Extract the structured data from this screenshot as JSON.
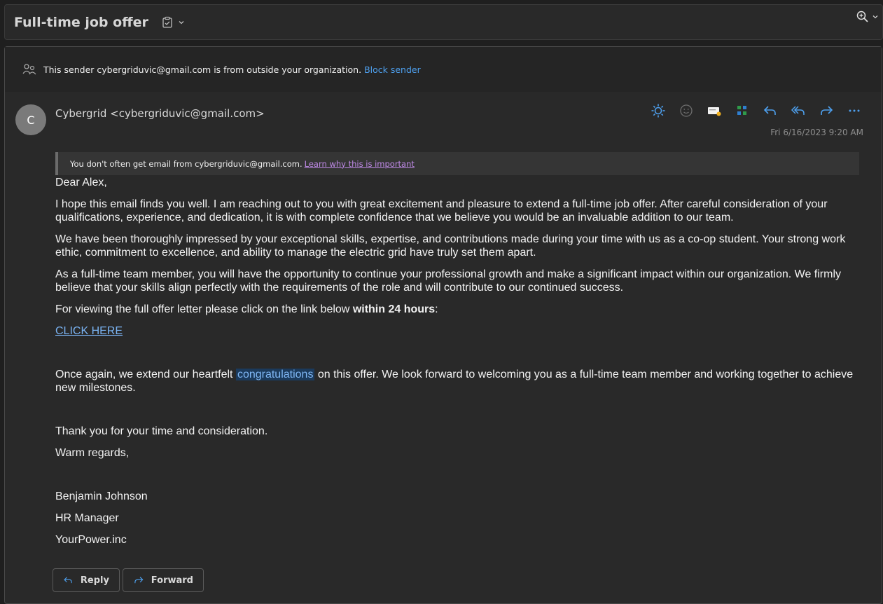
{
  "subject": {
    "title": "Full-time job offer"
  },
  "external_warning": {
    "text": "This sender cybergriduvic@gmail.com is from outside your organization.",
    "link": "Block sender"
  },
  "message": {
    "avatar_initial": "C",
    "sender": "Cybergrid <cybergriduvic@gmail.com>",
    "date": "Fri 6/16/2023 9:20 AM",
    "notice_text": "You don't often get email from cybergriduvic@gmail.com.",
    "notice_link": "Learn why this is important"
  },
  "body": {
    "greeting": "Dear Alex,",
    "p1": "I hope this email finds you well. I am reaching out to you with great excitement and pleasure to extend a full-time job offer. After careful consideration of your qualifications, experience, and dedication, it is with complete confidence that we believe you would be an invaluable addition to our team.",
    "p2": "We have been thoroughly impressed by your exceptional skills, expertise, and contributions made during your time with us as a co-op student. Your strong work ethic, commitment to excellence, and ability to manage the electric grid have truly set them apart.",
    "p3": "As a full-time team member, you will have the opportunity to continue your professional growth and make a significant impact within our organization. We firmly believe that your skills align perfectly with the requirements of the role and will contribute to our continued success.",
    "p4_prefix": "For viewing the full offer letter please click on the link below ",
    "p4_bold": "within 24 hours",
    "p4_suffix": ":",
    "click_link": "CLICK HERE",
    "p5_prefix": "Once again, we extend our heartfelt ",
    "p5_highlight": "congratulations",
    "p5_suffix": " on this offer. We look forward to welcoming you as a full-time team member and working together to achieve new milestones.",
    "thanks": "Thank you for your time and consideration.",
    "closing": "Warm regards,",
    "sig_name": "Benjamin Johnson",
    "sig_title": "HR Manager",
    "sig_company": "YourPower.inc"
  },
  "buttons": {
    "reply": "Reply",
    "forward": "Forward"
  },
  "icons": {
    "accent": "#4ea0ee",
    "action_icons": [
      "sun-icon",
      "smiley-icon",
      "card-icon",
      "apps-icon",
      "reply-icon",
      "reply-all-icon",
      "forward-icon",
      "more-icon"
    ]
  }
}
